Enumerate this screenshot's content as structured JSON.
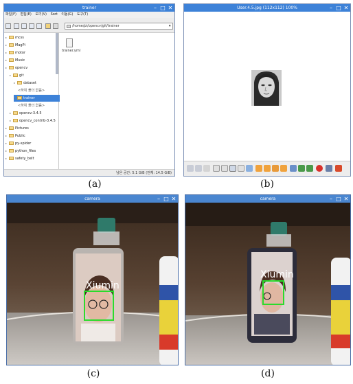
{
  "panels": {
    "a": {
      "caption": "(a)",
      "window_title": "trainer",
      "menu": [
        "파일(F)",
        "편집(E)",
        "보기(V)",
        "Sort",
        "이동(G)",
        "도구(T)"
      ],
      "path": "/home/pi/opencv/git/trainer",
      "tree": [
        {
          "label": "mcss",
          "indent": 0
        },
        {
          "label": "MagPi",
          "indent": 0
        },
        {
          "label": "motor",
          "indent": 0
        },
        {
          "label": "Music",
          "indent": 0
        },
        {
          "label": "opencv",
          "indent": 0
        },
        {
          "label": "git",
          "indent": 1
        },
        {
          "label": "dataset",
          "indent": 2
        },
        {
          "label": "<하위 폴더 없음>",
          "indent": 3
        },
        {
          "label": "trainer",
          "indent": 2
        },
        {
          "label": "<하위 폴더 없음>",
          "indent": 3
        },
        {
          "label": "opencv-3.4.5",
          "indent": 1
        },
        {
          "label": "opencv_contrib-3.4.5",
          "indent": 1
        },
        {
          "label": "Pictures",
          "indent": 0
        },
        {
          "label": "Public",
          "indent": 0
        },
        {
          "label": "py-spider",
          "indent": 0
        },
        {
          "label": "python_files",
          "indent": 0
        },
        {
          "label": "safety_belt",
          "indent": 0
        }
      ],
      "selected_item": "trainer",
      "file_name": "trainer.yml",
      "status": "남은 공간: 5.1 GiB (전체: 14.5 GiB)"
    },
    "b": {
      "caption": "(b)",
      "window_title": "User.4.5.jpg (112x112) 100%"
    },
    "c": {
      "caption": "(c)",
      "window_title": "camera",
      "overlay_name": "Xiumin"
    },
    "d": {
      "caption": "(d)",
      "window_title": "camera",
      "overlay_name": "Xiumin"
    }
  },
  "icons": {
    "minimize": "minimize-icon",
    "maximize": "maximize-icon",
    "close": "close-icon",
    "folder": "folder-icon",
    "file": "file-icon"
  },
  "colors": {
    "titlebar": "#3d82d8",
    "selection": "#3d82d8",
    "face_box": "#2bdb2b",
    "overlay_text": "#ffffff"
  }
}
